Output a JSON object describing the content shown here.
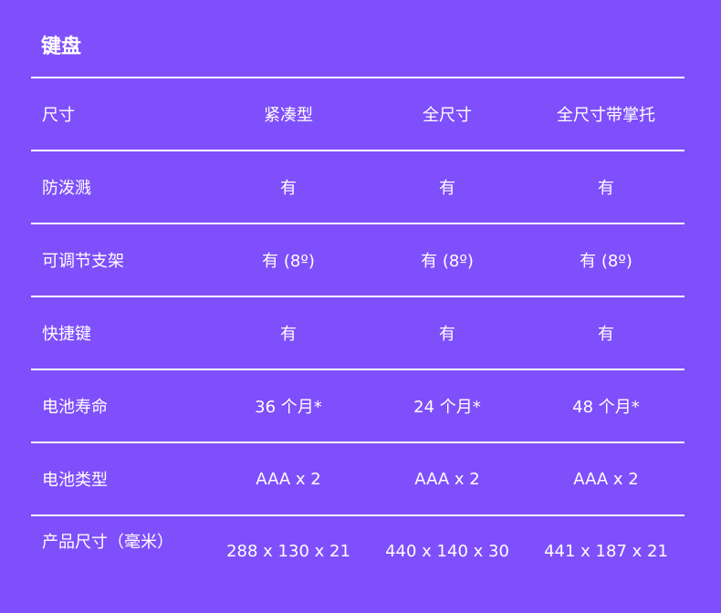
{
  "title": "键盘",
  "rows": [
    {
      "label": "尺寸",
      "values": [
        "紧凑型",
        "全尺寸",
        "全尺寸带掌托"
      ]
    },
    {
      "label": "防泼溅",
      "values": [
        "有",
        "有",
        "有"
      ]
    },
    {
      "label": "可调节支架",
      "values": [
        "有 (8º)",
        "有 (8º)",
        "有 (8º)"
      ]
    },
    {
      "label": "快捷键",
      "values": [
        "有",
        "有",
        "有"
      ]
    },
    {
      "label": "电池寿命",
      "values": [
        "36 个月*",
        "24 个月*",
        "48 个月*"
      ]
    },
    {
      "label": "电池类型",
      "values": [
        "AAA x 2",
        "AAA x 2",
        "AAA x 2"
      ]
    },
    {
      "label": "产品尺寸（毫米）",
      "values": [
        "288 x 130 x 21",
        "440 x 140 x 30",
        "441 x 187 x 21"
      ]
    }
  ]
}
